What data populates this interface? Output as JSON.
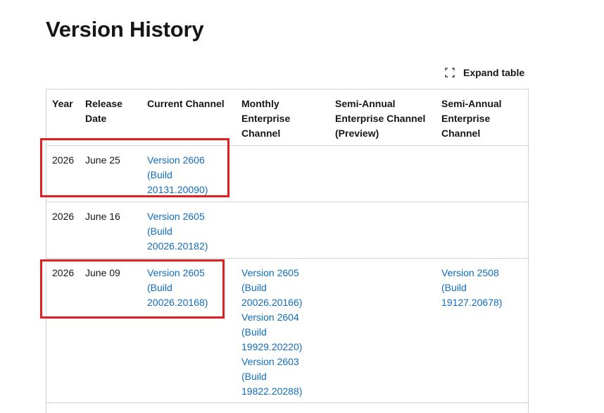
{
  "page": {
    "title": "Version History"
  },
  "toolbar": {
    "expand_label": "Expand table",
    "expand_icon": "expand-icon"
  },
  "table": {
    "headers": {
      "year": "Year",
      "release_date_l1": "Release",
      "release_date_l2": "Date",
      "current": "Current Channel",
      "monthly_l1": "Monthly",
      "monthly_l2": "Enterprise",
      "monthly_l3": "Channel",
      "sap_l1": "Semi-Annual",
      "sap_l2": "Enterprise Channel",
      "sap_l3": "(Preview)",
      "sae_l1": "Semi-Annual",
      "sae_l2": "Enterprise",
      "sae_l3": "Channel"
    },
    "rows": [
      {
        "year": "2026",
        "date": "June 25",
        "current": {
          "l1": "Version 2606",
          "l2": "(Build",
          "l3": "20131.20090)"
        }
      },
      {
        "year": "2026",
        "date": "June 16",
        "current": {
          "l1": "Version 2605",
          "l2": "(Build",
          "l3": "20026.20182)"
        }
      },
      {
        "year": "2026",
        "date": "June 09",
        "current": {
          "l1": "Version 2605",
          "l2": "(Build",
          "l3": "20026.20168)"
        },
        "monthly": [
          {
            "l1": "Version 2605",
            "l2": "(Build",
            "l3": "20026.20166)"
          },
          {
            "l1": "Version 2604",
            "l2": "(Build",
            "l3": "19929.20220)"
          },
          {
            "l1": "Version 2603",
            "l2": "(Build",
            "l3": "19822.20288)"
          }
        ],
        "sae": {
          "l1": "Version 2508",
          "l2": "(Build",
          "l3": "19127.20678)"
        }
      }
    ]
  },
  "colors": {
    "link": "#0f6cbd",
    "highlight": "#e02020",
    "border": "#d1d1d1"
  }
}
